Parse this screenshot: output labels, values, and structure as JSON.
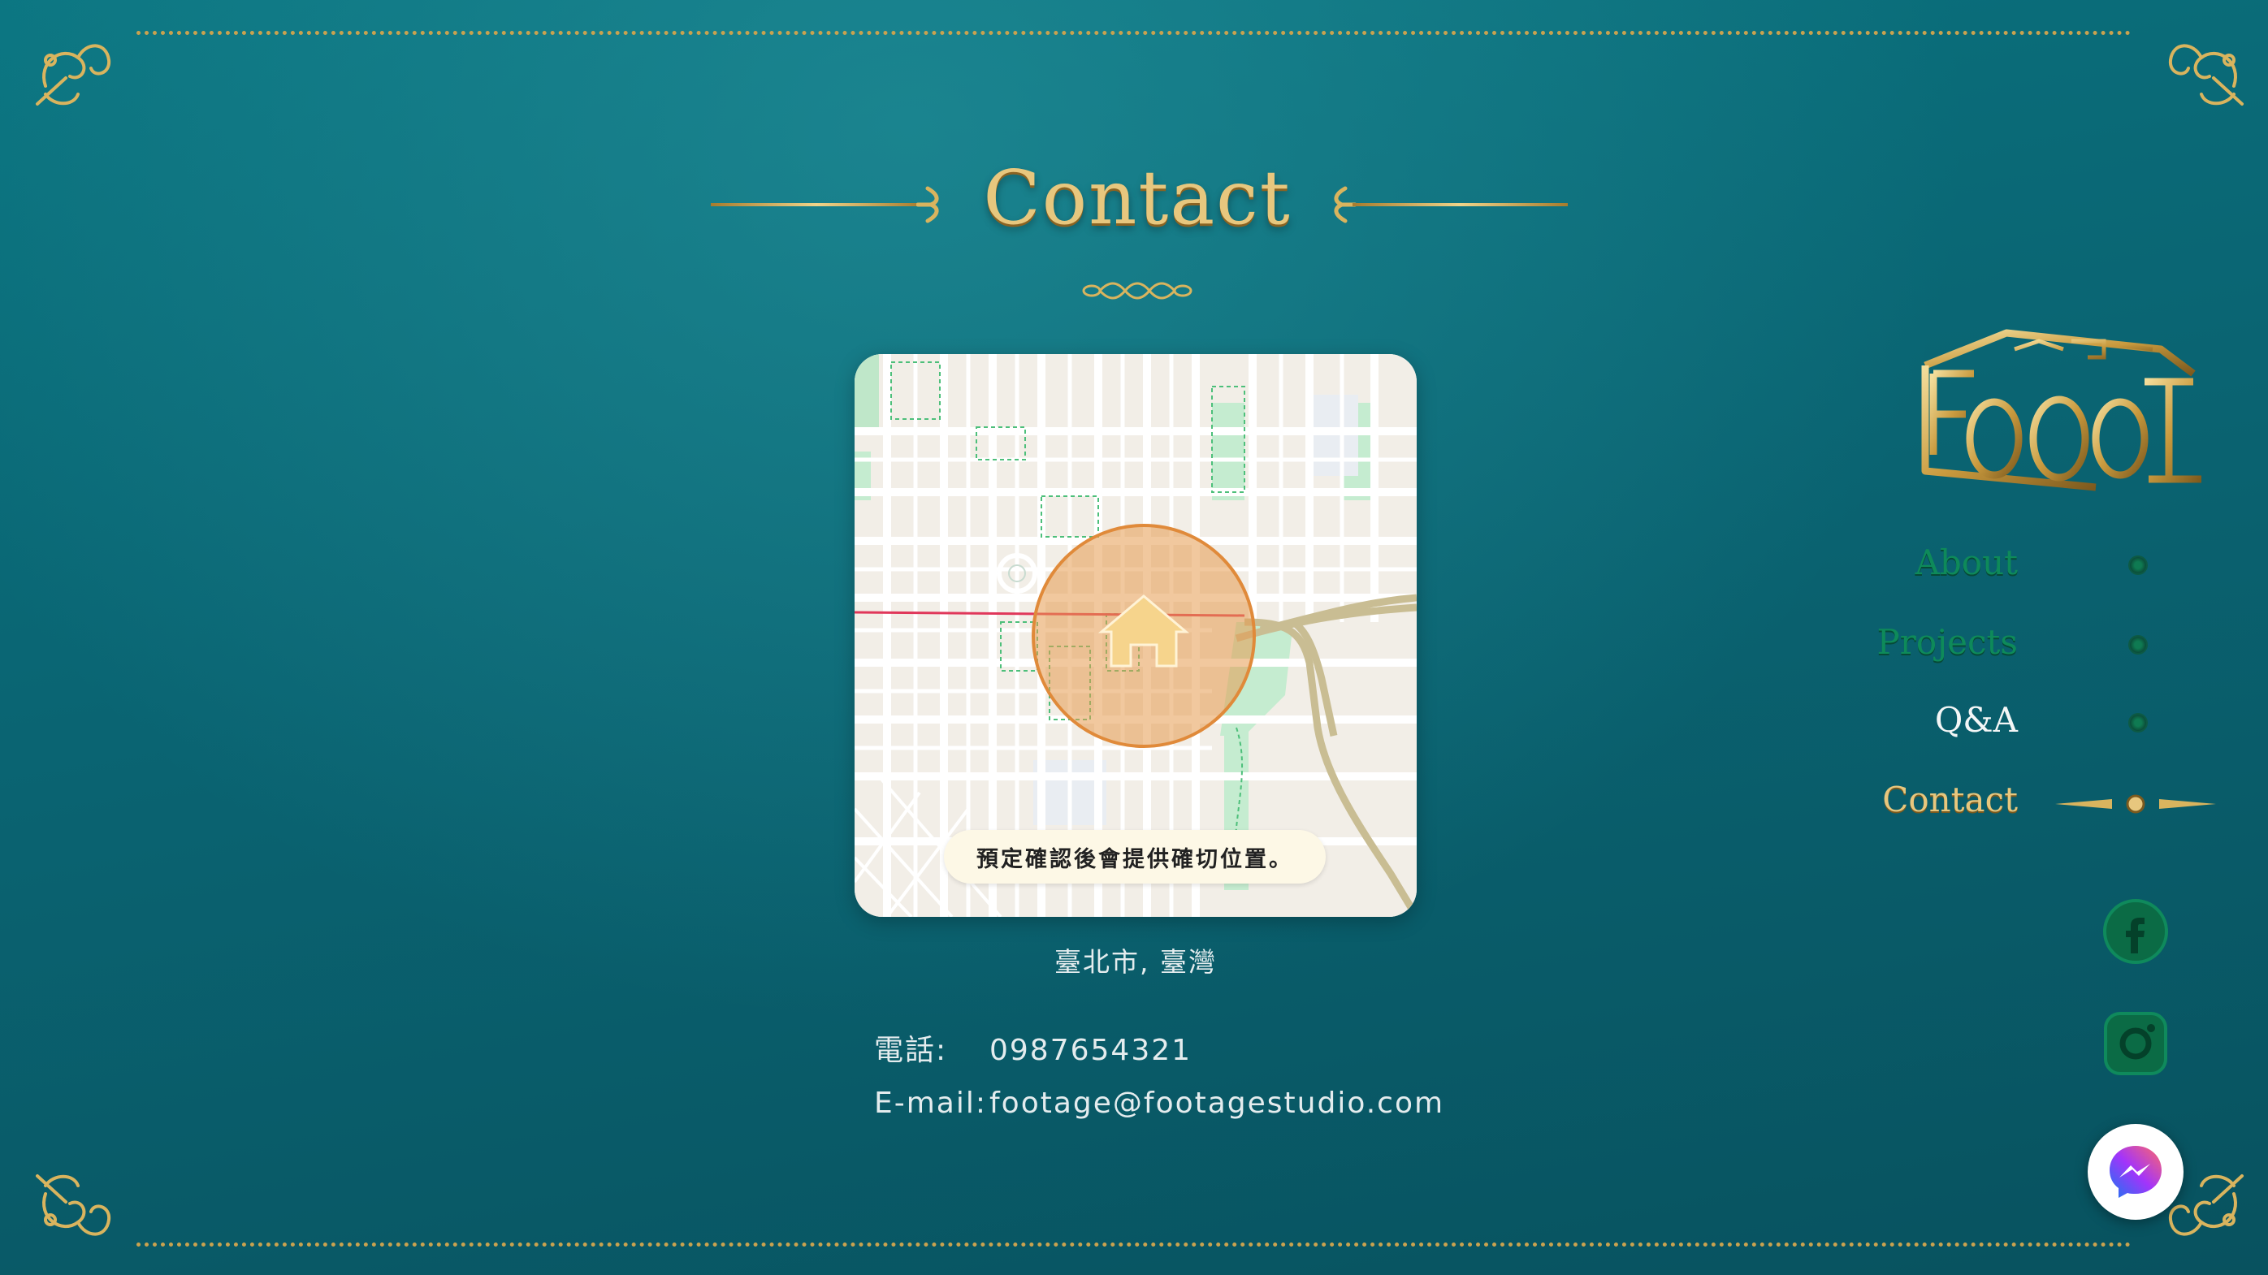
{
  "page": {
    "title": "Contact"
  },
  "map": {
    "note": "預定確認後會提供確切位置。",
    "location": "臺北市, 臺灣"
  },
  "contact": {
    "phone_label": "電話:",
    "phone": "0987654321",
    "email_label": "E-mail:",
    "email": "footage@footagestudio.com"
  },
  "nav": {
    "items": [
      {
        "label": "About",
        "active": false,
        "color": "#0e8a5a"
      },
      {
        "label": "Projects",
        "active": false,
        "color": "#0e8a5a"
      },
      {
        "label": "Q&A",
        "active": false,
        "color": "#f3f6f6"
      },
      {
        "label": "Contact",
        "active": true,
        "color": "#e7c77e"
      }
    ]
  },
  "social": {
    "icons": [
      "facebook-icon",
      "instagram-icon",
      "messenger-icon"
    ]
  },
  "colors": {
    "background": "#0a6472",
    "gold": "#e7c77e",
    "nav_green": "#0e8a5a",
    "marker_orange": "#e59a4e"
  }
}
